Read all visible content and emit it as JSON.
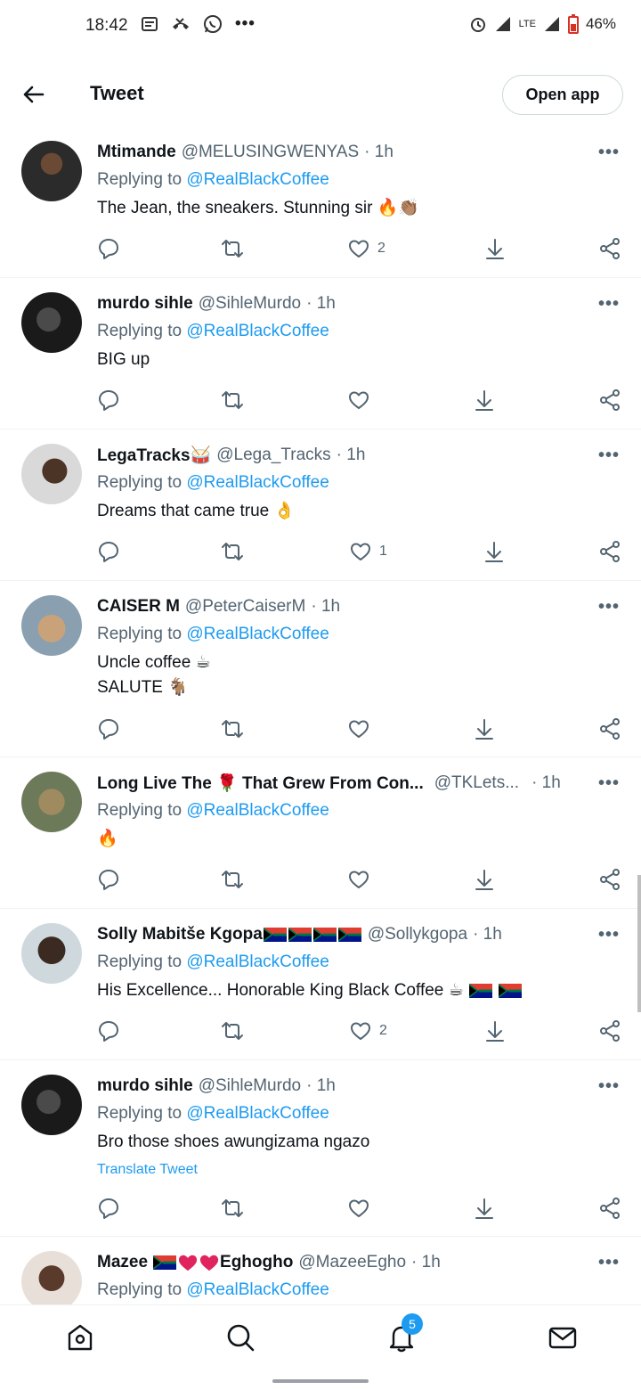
{
  "status_bar": {
    "time": "18:42",
    "network": "LTE",
    "battery": "46%"
  },
  "header": {
    "title": "Tweet",
    "open_app_label": "Open app"
  },
  "replying_prefix": "Replying to",
  "replying_handle": "@RealBlackCoffee",
  "tweets": [
    {
      "name": "Mtimande",
      "handle": "@MELUSINGWENYAS",
      "time": "· 1h",
      "lines": [
        "The Jean, the sneakers. Stunning sir 🔥👏🏽"
      ],
      "likes": "2"
    },
    {
      "name": "murdo sihle",
      "handle": "@SihleMurdo",
      "time": "· 1h",
      "lines": [
        "BIG up"
      ],
      "likes": ""
    },
    {
      "name": "LegaTracks🥁",
      "handle": "@Lega_Tracks",
      "time": "· 1h",
      "lines": [
        "Dreams that came true 👌"
      ],
      "likes": "1"
    },
    {
      "name": "CAISER M",
      "handle": "@PeterCaiserM",
      "time": "· 1h",
      "lines": [
        "Uncle coffee ☕",
        "SALUTE 🐐"
      ],
      "likes": ""
    },
    {
      "name": "Long Live The 🌹 That Grew From Con...",
      "handle": "@TKLets...",
      "time": "· 1h",
      "lines": [
        "🔥"
      ],
      "likes": ""
    },
    {
      "name": "Solly Mabitše Kgopa",
      "handle": "@Sollykgopa",
      "time": "· 1h",
      "lines": [
        "His Excellence... Honorable King Black Coffee ☕"
      ],
      "likes": "2"
    },
    {
      "name": "murdo sihle",
      "handle": "@SihleMurdo",
      "time": "· 1h",
      "lines": [
        "Bro those  shoes  awungizama ngazo"
      ],
      "likes": "",
      "translate": "Translate Tweet"
    },
    {
      "name_part1": "Mazee",
      "name_part2": "Eghogho",
      "handle": "@MazeeEgho",
      "time": "· 1h"
    }
  ],
  "bottom_nav": {
    "notifications_badge": "5"
  },
  "colors": {
    "link": "#1d9bf0",
    "muted": "#536471",
    "text": "#0f1419"
  }
}
